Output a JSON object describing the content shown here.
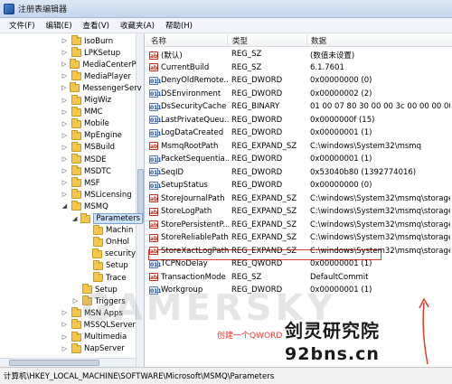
{
  "window": {
    "title": "注册表编辑器"
  },
  "menu": [
    "文件(F)",
    "编辑(E)",
    "查看(V)",
    "收藏夹(A)",
    "帮助(H)"
  ],
  "tree": [
    {
      "label": "IsoBurn",
      "depth": 0,
      "expander": "▷"
    },
    {
      "label": "LPKSetup",
      "depth": 0,
      "expander": "▷"
    },
    {
      "label": "MediaCenterP",
      "depth": 0,
      "expander": "▷"
    },
    {
      "label": "MediaPlayer",
      "depth": 0,
      "expander": "▷"
    },
    {
      "label": "MessengerServ",
      "depth": 0,
      "expander": "▷"
    },
    {
      "label": "MigWiz",
      "depth": 0,
      "expander": "▷"
    },
    {
      "label": "MMC",
      "depth": 0,
      "expander": "▷"
    },
    {
      "label": "Mobile",
      "depth": 0,
      "expander": "▷"
    },
    {
      "label": "MpEngine",
      "depth": 0,
      "expander": "▷"
    },
    {
      "label": "MSBuild",
      "depth": 0,
      "expander": "▷"
    },
    {
      "label": "MSDE",
      "depth": 0,
      "expander": "▷"
    },
    {
      "label": "MSDTC",
      "depth": 0,
      "expander": "▷"
    },
    {
      "label": "MSF",
      "depth": 0,
      "expander": "▷"
    },
    {
      "label": "MSLicensing",
      "depth": 0,
      "expander": "▷"
    },
    {
      "label": "MSMQ",
      "depth": 0,
      "expander": "◢"
    },
    {
      "label": "Parameters",
      "depth": 1,
      "expander": "◢",
      "selected": true
    },
    {
      "label": "Machin",
      "depth": 2,
      "expander": ""
    },
    {
      "label": "OnHol",
      "depth": 2,
      "expander": ""
    },
    {
      "label": "security",
      "depth": 2,
      "expander": ""
    },
    {
      "label": "Setup",
      "depth": 2,
      "expander": ""
    },
    {
      "label": "Trace",
      "depth": 2,
      "expander": ""
    },
    {
      "label": "Setup",
      "depth": 1,
      "expander": ""
    },
    {
      "label": "Triggers",
      "depth": 1,
      "expander": "▷"
    },
    {
      "label": "MSN Apps",
      "depth": 0,
      "expander": "▷"
    },
    {
      "label": "MSSQLServer",
      "depth": 0,
      "expander": "▷"
    },
    {
      "label": "Multimedia",
      "depth": 0,
      "expander": "▷"
    },
    {
      "label": "NapServer",
      "depth": 0,
      "expander": "▷"
    }
  ],
  "columns": {
    "name": "名称",
    "type": "类型",
    "data": "数据"
  },
  "values": [
    {
      "name": "(默认)",
      "type": "REG_SZ",
      "data": "(数值未设置)",
      "icon": "ab"
    },
    {
      "name": "CurrentBuild",
      "type": "REG_SZ",
      "data": "6.1.7601",
      "icon": "ab"
    },
    {
      "name": "DenyOldRemote...",
      "type": "REG_DWORD",
      "data": "0x00000000 (0)",
      "icon": "bin"
    },
    {
      "name": "DSEnvironment",
      "type": "REG_DWORD",
      "data": "0x00000002 (2)",
      "icon": "bin"
    },
    {
      "name": "DsSecurityCache",
      "type": "REG_BINARY",
      "data": "01 00 07 80 30 00 00 3c 00 00 00 00 00 00",
      "icon": "bin"
    },
    {
      "name": "LastPrivateQueu...",
      "type": "REG_DWORD",
      "data": "0x0000000f (15)",
      "icon": "bin"
    },
    {
      "name": "LogDataCreated",
      "type": "REG_DWORD",
      "data": "0x00000001 (1)",
      "icon": "bin"
    },
    {
      "name": "MsmqRootPath",
      "type": "REG_EXPAND_SZ",
      "data": "C:\\windows\\System32\\msmq",
      "icon": "ab"
    },
    {
      "name": "PacketSequentia...",
      "type": "REG_DWORD",
      "data": "0x00000001 (1)",
      "icon": "bin"
    },
    {
      "name": "SeqID",
      "type": "REG_DWORD",
      "data": "0x53040b80 (1392774016)",
      "icon": "bin"
    },
    {
      "name": "SetupStatus",
      "type": "REG_DWORD",
      "data": "0x00000000 (0)",
      "icon": "bin"
    },
    {
      "name": "StoreJournalPath",
      "type": "REG_EXPAND_SZ",
      "data": "C:\\windows\\System32\\msmq\\storage",
      "icon": "ab"
    },
    {
      "name": "StoreLogPath",
      "type": "REG_EXPAND_SZ",
      "data": "C:\\windows\\System32\\msmq\\storage",
      "icon": "ab"
    },
    {
      "name": "StorePersistentP...",
      "type": "REG_EXPAND_SZ",
      "data": "C:\\windows\\System32\\msmq\\storage",
      "icon": "ab"
    },
    {
      "name": "StoreReliablePath",
      "type": "REG_EXPAND_SZ",
      "data": "C:\\windows\\System32\\msmq\\storage",
      "icon": "ab"
    },
    {
      "name": "StoreXactLogPath",
      "type": "REG_EXPAND_SZ",
      "data": "C:\\windows\\System32\\msmq\\storage",
      "icon": "ab"
    },
    {
      "name": "TCPNoDelay",
      "type": "REG_QWORD",
      "data": "0x00000001 (1)",
      "icon": "bin"
    },
    {
      "name": "TransactionMode",
      "type": "REG_SZ",
      "data": "DefaultCommit",
      "icon": "ab"
    },
    {
      "name": "Workgroup",
      "type": "REG_DWORD",
      "data": "0x00000001 (1)",
      "icon": "bin"
    }
  ],
  "annotation": "创建一个QWORD",
  "watermark": "GAMERSKY",
  "brand": {
    "cn": "剑灵研究院",
    "en": "92bns.cn"
  },
  "status": {
    "path": "计算机\\HKEY_LOCAL_MACHINE\\SOFTWARE\\Microsoft\\MSMQ\\Parameters"
  },
  "colors": {
    "annotation": "#e23a2c",
    "selection": "#cde3fb",
    "titlebar": "#c3d6ee"
  }
}
